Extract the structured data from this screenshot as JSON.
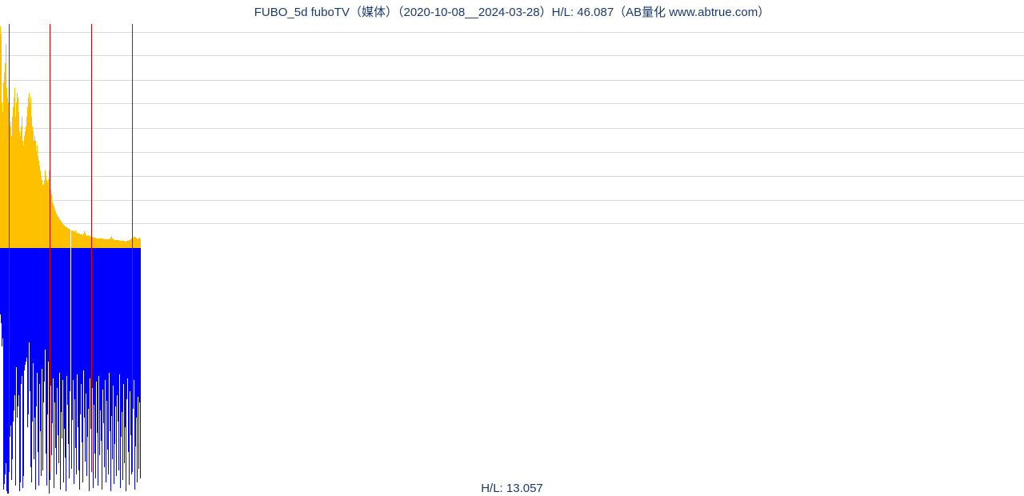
{
  "title": "FUBO_5d fuboTV（媒体）（2020-10-08__2024-03-28）H/L: 46.087（AB量化  www.abtrue.com）",
  "bottom_label": "H/L: 13.057",
  "colors": {
    "upper": "#ffc000",
    "lower": "#0000ff",
    "red": "#d10000",
    "grid": "#d8d8d8",
    "text": "#1a3a6e"
  },
  "chart_data": {
    "type": "bar",
    "description": "Two stacked price-range histograms for FUBO 5-day data. Upper panel (yellow, H/L up to 46.087) plots bar height upward from a shared midline; lower panel (blue, H/L up to 13.057) plots bar depth downward from the same midline. X axis is approximately 175 5-day buckets spanning 2020-10-08 to 2024-03-28. A few red vertical marker lines overlay specific buckets.",
    "title": "FUBO_5d fuboTV（媒体）（2020-10-08__2024-03-28）",
    "xlabel": "",
    "ylabel_upper": "H/L",
    "ylabel_lower": "H/L",
    "ylim_upper": [
      0,
      46.087
    ],
    "ylim_lower": [
      0,
      13.057
    ],
    "upper_hl_max": 46.087,
    "lower_hl_max": 13.057,
    "grid_levels_upper_fraction": [
      0.11,
      0.215,
      0.32,
      0.43,
      0.535,
      0.645,
      0.75,
      0.86,
      0.965
    ],
    "red_marker_indices": [
      11,
      62,
      113,
      164
    ],
    "series": [
      {
        "name": "upper_yellow_HL",
        "max_value": 46.087,
        "values": [
          45.6,
          44.0,
          30.0,
          28.0,
          34.0,
          36.0,
          38.0,
          42.0,
          33.0,
          31.0,
          30.0,
          23.0,
          25.0,
          26.0,
          23.0,
          27.0,
          29.0,
          31.0,
          33.0,
          27.0,
          30.0,
          32.0,
          31.0,
          28.0,
          24.0,
          23.0,
          25.0,
          27.0,
          22.0,
          21.0,
          23.0,
          24.0,
          25.0,
          27.0,
          29.0,
          31.0,
          32.0,
          30.0,
          31.0,
          27.0,
          25.0,
          24.0,
          22.0,
          23.0,
          22.0,
          20.0,
          21.0,
          19.0,
          18.0,
          17.0,
          16.0,
          15.0,
          14.0,
          13.0,
          13.0,
          14.0,
          16.0,
          15.0,
          14.0,
          13.5,
          14.2,
          16.0,
          13.0,
          12.0,
          11.0,
          9.5,
          9.0,
          8.5,
          8.0,
          7.5,
          7.0,
          6.8,
          6.5,
          6.2,
          6.0,
          5.7,
          5.5,
          5.3,
          5.0,
          4.8,
          4.6,
          4.5,
          4.3,
          4.2,
          4.1,
          4.0,
          3.9,
          3.8,
          3.7,
          3.6,
          3.5,
          3.4,
          3.3,
          3.6,
          3.2,
          3.1,
          3.0,
          2.95,
          2.9,
          2.85,
          2.8,
          2.75,
          2.7,
          3.0,
          3.4,
          3.1,
          2.6,
          2.55,
          2.5,
          2.7,
          2.45,
          2.4,
          2.35,
          2.3,
          2.25,
          2.2,
          2.15,
          2.1,
          2.1,
          2.05,
          2.05,
          2.0,
          2.0,
          1.98,
          1.95,
          1.95,
          1.9,
          1.9,
          1.88,
          1.85,
          1.85,
          1.8,
          1.8,
          1.78,
          1.75,
          1.8,
          2.0,
          2.2,
          2.4,
          1.9,
          1.75,
          1.7,
          1.7,
          1.68,
          1.65,
          1.6,
          1.6,
          1.58,
          1.55,
          1.55,
          1.5,
          1.5,
          1.48,
          1.45,
          1.45,
          1.4,
          1.4,
          1.45,
          1.5,
          1.55,
          1.6,
          1.7,
          1.8,
          1.9,
          2.0,
          2.2,
          2.4,
          2.3,
          2.2,
          2.0,
          1.9,
          1.8,
          1.9,
          2.1,
          1.8
        ]
      },
      {
        "name": "lower_blue_HL",
        "max_value": 13.057,
        "values": [
          3.5,
          4.0,
          5.2,
          4.8,
          12.8,
          12.5,
          12.0,
          11.4,
          12.9,
          13.0,
          13.0,
          11.0,
          10.0,
          9.4,
          12.3,
          11.2,
          9.2,
          8.6,
          7.8,
          12.6,
          6.3,
          9.0,
          8.4,
          7.8,
          12.9,
          12.4,
          7.2,
          6.8,
          12.7,
          12.1,
          6.5,
          6.2,
          6.0,
          5.8,
          9.5,
          8.8,
          5.0,
          7.6,
          11.6,
          12.4,
          9.2,
          6.1,
          11.2,
          9.0,
          12.8,
          8.4,
          6.6,
          10.8,
          12.6,
          7.2,
          9.7,
          12.1,
          6.4,
          11.8,
          8.2,
          7.1,
          5.4,
          10.9,
          12.6,
          8.8,
          6.0,
          13.0,
          12.3,
          7.3,
          11.0,
          9.3,
          6.9,
          12.7,
          8.2,
          10.6,
          12.0,
          7.4,
          9.9,
          11.4,
          6.6,
          12.8,
          8.7,
          10.1,
          7.0,
          12.4,
          9.6,
          11.1,
          12.9,
          6.8,
          8.3,
          10.4,
          12.2,
          7.6,
          11.7,
          9.1,
          7.0,
          12.5,
          8.0,
          10.6,
          12.0,
          6.7,
          9.5,
          11.8,
          12.8,
          8.8,
          7.2,
          10.3,
          12.4,
          6.5,
          9.0,
          11.3,
          7.7,
          12.1,
          10.0,
          8.5,
          12.9,
          6.9,
          9.6,
          11.5,
          7.4,
          12.7,
          8.3,
          10.9,
          12.2,
          7.1,
          9.8,
          12.6,
          6.8,
          11.0,
          8.6,
          10.2,
          12.8,
          7.5,
          9.3,
          11.6,
          7.0,
          12.4,
          8.1,
          10.7,
          12.0,
          6.6,
          9.7,
          12.9,
          8.9,
          11.2,
          7.3,
          12.5,
          10.4,
          8.4,
          12.1,
          7.8,
          9.2,
          11.8,
          6.7,
          12.7,
          10.0,
          8.7,
          12.3,
          7.2,
          11.4,
          9.5,
          12.9,
          8.0,
          6.9,
          10.8,
          12.56,
          7.6,
          9.9,
          12.0,
          11.3,
          8.5,
          7.0,
          12.8,
          10.5,
          9.0,
          12.4,
          7.9,
          11.7,
          8.2,
          12.2
        ]
      }
    ]
  }
}
